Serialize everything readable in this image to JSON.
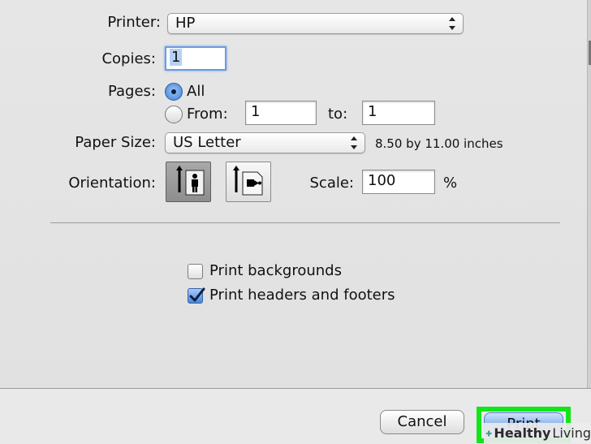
{
  "printer": {
    "label": "Printer:",
    "value": "HP"
  },
  "copies": {
    "label": "Copies:",
    "value": "1"
  },
  "pages": {
    "label": "Pages:",
    "all_label": "All",
    "from_label": "From:",
    "from_value": "1",
    "to_label": "to:",
    "to_value": "1",
    "selected": "all"
  },
  "paper_size": {
    "label": "Paper Size:",
    "value": "US Letter",
    "dimensions": "8.50 by 11.00 inches"
  },
  "orientation": {
    "label": "Orientation:",
    "selected": "portrait"
  },
  "scale": {
    "label": "Scale:",
    "value": "100",
    "unit": "%"
  },
  "options": [
    {
      "label": "Print backgrounds",
      "checked": false
    },
    {
      "label": "Print headers and footers",
      "checked": true
    }
  ],
  "buttons": {
    "cancel": "Cancel",
    "print": "Print"
  },
  "watermark": {
    "brand_bold": "Healthy",
    "brand_regular": "Living"
  },
  "colors": {
    "highlight": "#12e51a",
    "accent": "#4a86d8"
  }
}
